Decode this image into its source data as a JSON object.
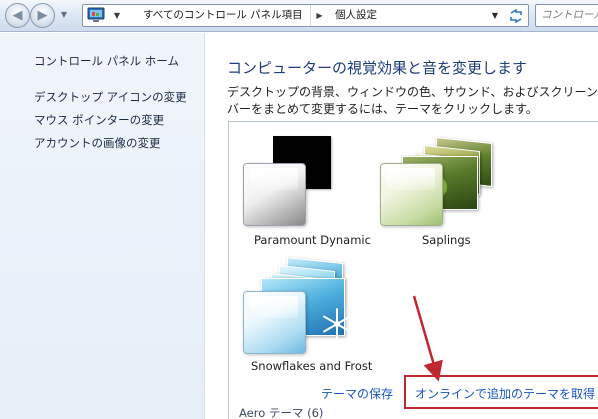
{
  "navbar": {
    "breadcrumb_1": "すべてのコントロール パネル項目",
    "breadcrumb_2": "個人設定",
    "search_placeholder": "コントロール パ"
  },
  "sidebar": {
    "home": "コントロール パネル ホーム",
    "links": [
      "デスクトップ アイコンの変更",
      "マウス ポインターの変更",
      "アカウントの画像の変更"
    ]
  },
  "main": {
    "title": "コンピューターの視覚効果と音を変更します",
    "description_line1": "デスクトップの背景、ウィンドウの色、サウンド、およびスクリーン",
    "description_line2": "バーをまとめて変更するには、テーマをクリックします。",
    "themes": [
      {
        "name": "Paramount Dynamic"
      },
      {
        "name": "Saplings"
      },
      {
        "name": "Snowflakes and Frost"
      }
    ],
    "save_theme_link": "テーマの保存",
    "online_themes_link": "オンラインで追加のテーマを取得",
    "aero_section": {
      "label": "Aero テーマ",
      "count": "(6)"
    }
  },
  "colors": {
    "title_blue": "#1e3c7b",
    "link_blue": "#1a55c0",
    "highlight_red": "#c0282f",
    "sidebar_bg": "#e9f0f9"
  }
}
